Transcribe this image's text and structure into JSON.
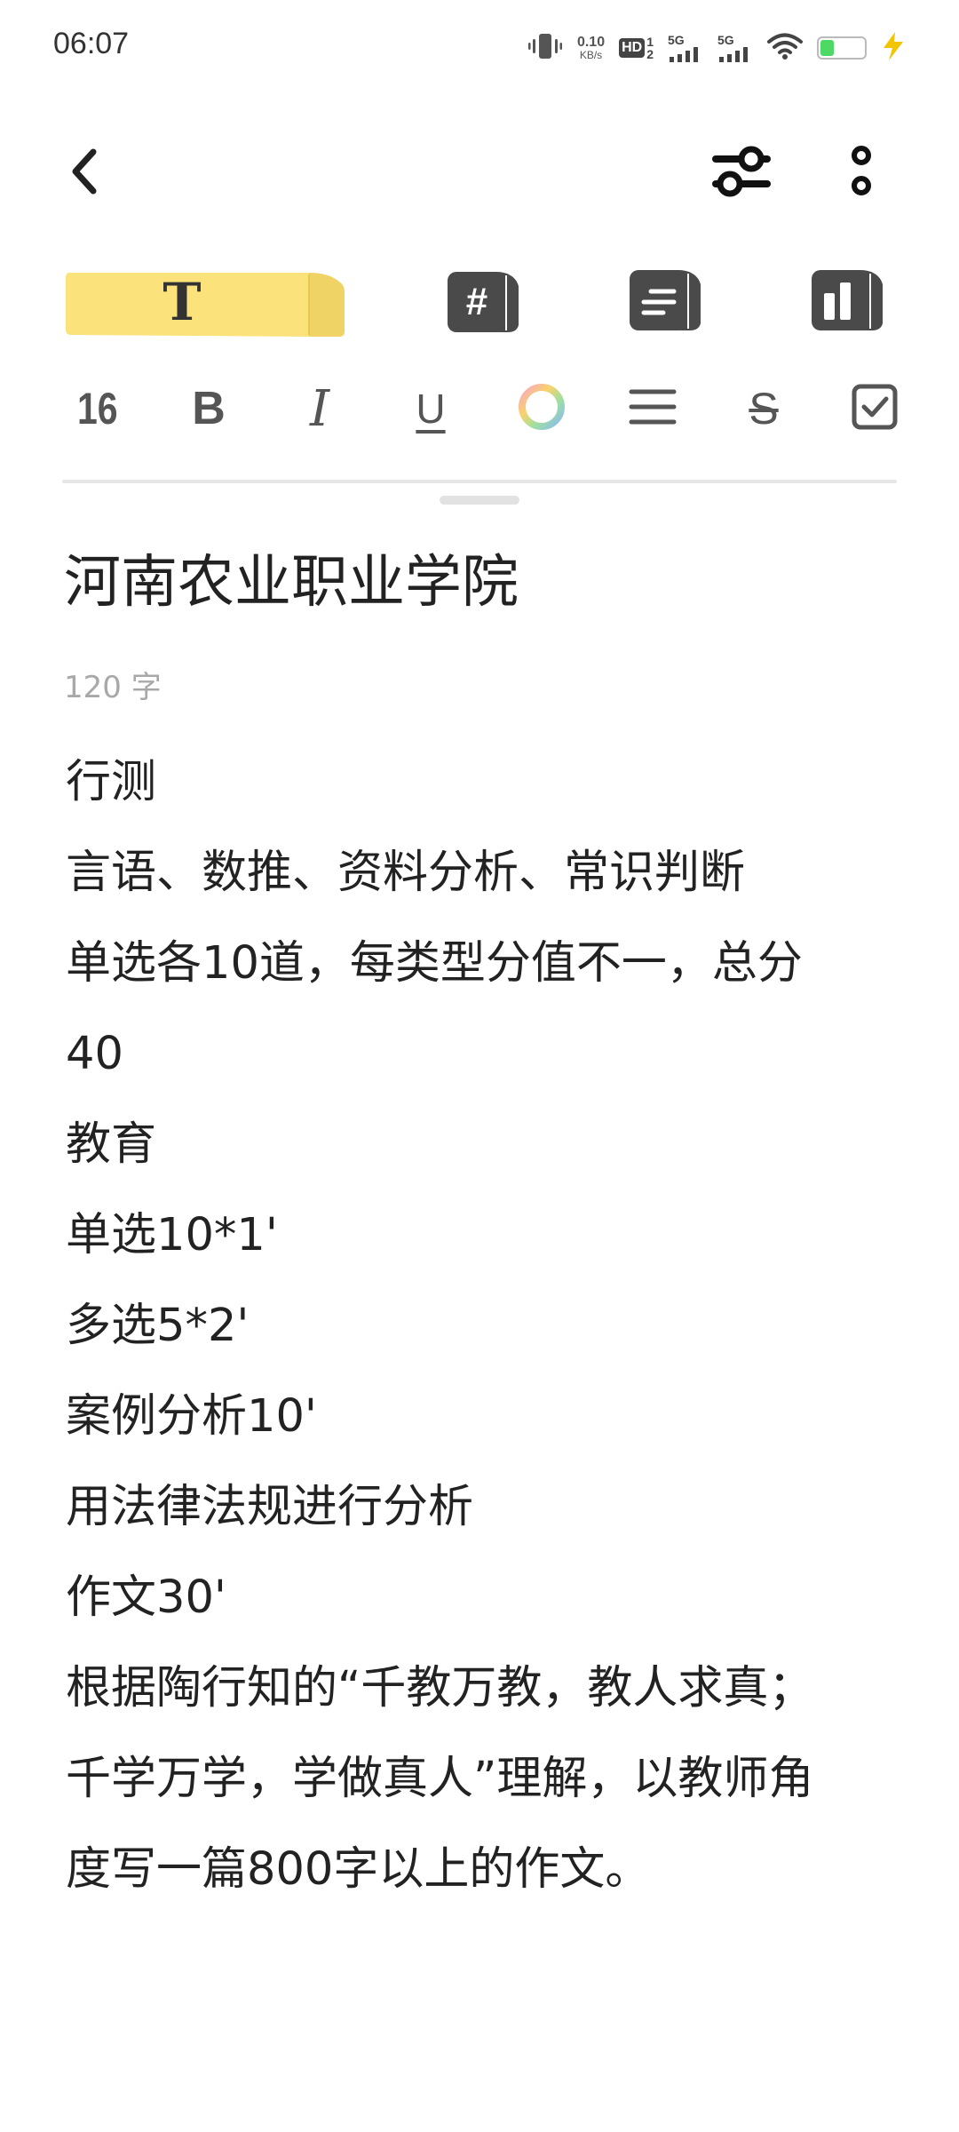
{
  "status_bar": {
    "time": "06:07",
    "net_speed_value": "0.10",
    "net_speed_unit": "KB/s",
    "hd_label": "HD",
    "hd_sim_top": "1",
    "hd_sim_bottom": "2",
    "sim1_label": "5G",
    "sim2_label": "5G",
    "battery_level": "32",
    "battery_fraction": 0.32,
    "battery_color": "#4cd964",
    "charging_color": "#f2c500"
  },
  "app_bar": {
    "back_icon": "chevron-left-icon",
    "settings_icon": "sliders-icon",
    "more_icon": "more-vertical-icon"
  },
  "toolbar": {
    "tabs": [
      {
        "name": "text",
        "label": "T",
        "active": true
      },
      {
        "name": "tag",
        "label": "#",
        "active": false
      },
      {
        "name": "list",
        "icon": "list-book-icon",
        "active": false
      },
      {
        "name": "layout",
        "icon": "layout-book-icon",
        "active": false
      }
    ],
    "active_color": "#fbe27a"
  },
  "format": {
    "font_size": "16",
    "bold": "B",
    "italic": "I",
    "underline": "U",
    "color_icon": "color-wheel-icon",
    "align_icon": "align-icon",
    "strikethrough": "S",
    "checkbox_icon": "checkbox-icon"
  },
  "note": {
    "title": "河南农业职业学院",
    "word_count": "120 字",
    "lines": [
      "行测",
      "言语、数推、资料分析、常识判断",
      "单选各10道，每类型分值不一，总分",
      "40",
      "教育",
      "单选10*1'",
      "多选5*2'",
      "案例分析10'",
      "用法律法规进行分析",
      "作文30'",
      "根据陶行知的“千教万教，教人求真；",
      "千学万学，学做真人”理解，以教师角",
      "度写一篇800字以上的作文。"
    ]
  }
}
